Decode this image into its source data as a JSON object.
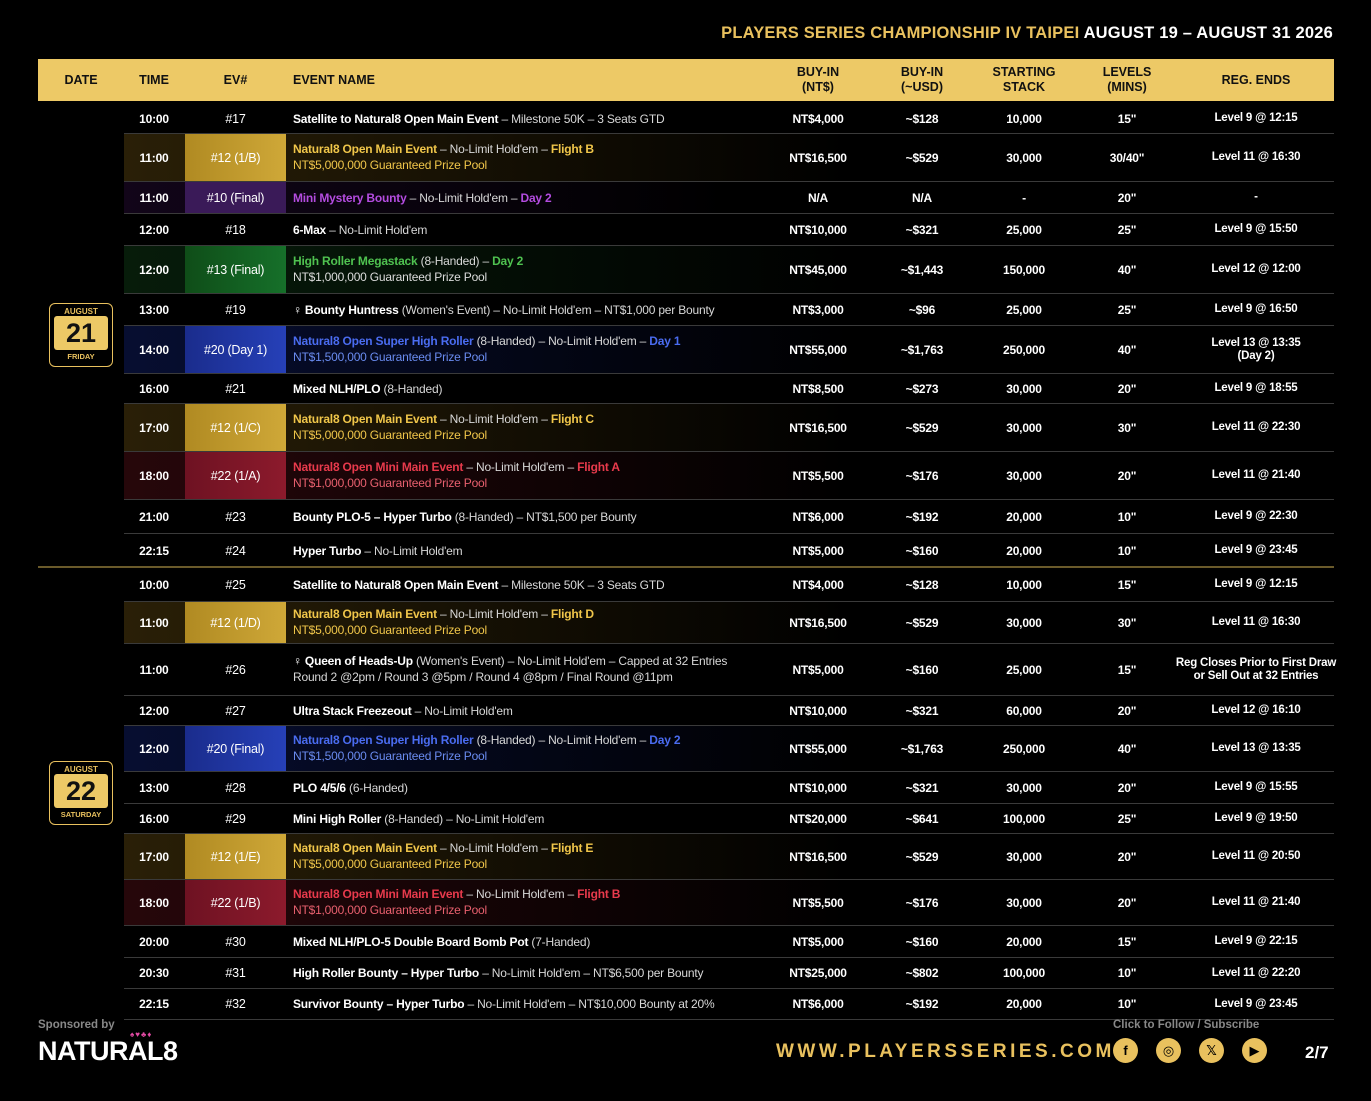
{
  "title": {
    "gold": "PLAYERS SERIES CHAMPIONSHIP IV TAIPEI",
    "white": "AUGUST 19 – AUGUST 31 2026"
  },
  "headers": {
    "date": "DATE",
    "time": "TIME",
    "ev": "EV#",
    "name": "EVENT NAME",
    "buyin_nt": "BUY-IN\n(NT$)",
    "buyin_usd": "BUY-IN\n(~USD)",
    "stack": "STARTING\nSTACK",
    "levels": "LEVELS\n(MINS)",
    "reg": "REG. ENDS"
  },
  "days": [
    {
      "month": "AUGUST",
      "day": "21",
      "dow": "FRIDAY"
    },
    {
      "month": "AUGUST",
      "day": "22",
      "dow": "SATURDAY"
    }
  ],
  "rows": [
    {
      "time": "10:00",
      "ev": "#17",
      "name": "Satellite to Natural8 Open Main Event",
      "rest": " – Milestone 50K – 3 Seats GTD",
      "sub": "",
      "nt": "NT$4,000",
      "usd": "~$128",
      "stack": "10,000",
      "lvl": "15\"",
      "reg": "Level 9 @ 12:15",
      "h": 30
    },
    {
      "time": "11:00",
      "ev": "#12 (1/B)",
      "color": "gold",
      "name": "Natural8 Open Main Event",
      "rest": " – No-Limit Hold'em – ",
      "flight": "Flight B",
      "sub": "NT$5,000,000 Guaranteed Prize Pool",
      "nt": "NT$16,500",
      "usd": "~$529",
      "stack": "30,000",
      "lvl": "30/40\"",
      "reg": "Level 11 @ 16:30",
      "h": 48
    },
    {
      "time": "11:00",
      "ev": "#10 (Final)",
      "color": "purple",
      "name": "Mini Mystery Bounty",
      "rest": " – No-Limit Hold'em – ",
      "flight": "Day 2",
      "sub": "",
      "nt": "N/A",
      "usd": "N/A",
      "stack": "-",
      "lvl": "20\"",
      "reg": "-",
      "h": 32
    },
    {
      "time": "12:00",
      "ev": "#18",
      "name": "6-Max",
      "rest": " – No-Limit Hold'em",
      "sub": "",
      "nt": "NT$10,000",
      "usd": "~$321",
      "stack": "25,000",
      "lvl": "25\"",
      "reg": "Level 9 @ 15:50",
      "h": 32
    },
    {
      "time": "12:00",
      "ev": "#13 (Final)",
      "color": "green",
      "name": "High Roller Megastack",
      "rest": " (8-Handed) – ",
      "flight": "Day 2",
      "sub": "NT$1,000,000 Guaranteed Prize Pool",
      "nt": "NT$45,000",
      "usd": "~$1,443",
      "stack": "150,000",
      "lvl": "40\"",
      "reg": "Level 12 @ 12:00",
      "h": 48
    },
    {
      "time": "13:00",
      "ev": "#19",
      "name": "♀ Bounty Huntress",
      "rest": " (Women's Event) – No-Limit Hold'em – NT$1,000 per Bounty",
      "sub": "",
      "nt": "NT$3,000",
      "usd": "~$96",
      "stack": "25,000",
      "lvl": "25\"",
      "reg": "Level 9 @ 16:50",
      "h": 32
    },
    {
      "time": "14:00",
      "ev": "#20 (Day 1)",
      "color": "blue",
      "name": "Natural8 Open Super High Roller",
      "rest": " (8-Handed) – No-Limit Hold'em – ",
      "flight": "Day 1",
      "sub": "NT$1,500,000 Guaranteed Prize Pool",
      "nt": "NT$55,000",
      "usd": "~$1,763",
      "stack": "250,000",
      "lvl": "40\"",
      "reg": "Level 13 @ 13:35\n(Day 2)",
      "h": 48
    },
    {
      "time": "16:00",
      "ev": "#21",
      "name": "Mixed NLH/PLO",
      "rest": " (8-Handed)",
      "sub": "",
      "nt": "NT$8,500",
      "usd": "~$273",
      "stack": "30,000",
      "lvl": "20\"",
      "reg": "Level 9 @ 18:55",
      "h": 30
    },
    {
      "time": "17:00",
      "ev": "#12 (1/C)",
      "color": "gold",
      "name": "Natural8 Open Main Event",
      "rest": " – No-Limit Hold'em – ",
      "flight": "Flight C",
      "sub": "NT$5,000,000 Guaranteed Prize Pool",
      "nt": "NT$16,500",
      "usd": "~$529",
      "stack": "30,000",
      "lvl": "30\"",
      "reg": "Level 11 @ 22:30",
      "h": 48
    },
    {
      "time": "18:00",
      "ev": "#22 (1/A)",
      "color": "red",
      "name": "Natural8 Open Mini Main Event",
      "rest": " – No-Limit Hold'em – ",
      "flight": "Flight A",
      "sub": "NT$1,000,000 Guaranteed Prize Pool",
      "nt": "NT$5,500",
      "usd": "~$176",
      "stack": "30,000",
      "lvl": "20\"",
      "reg": "Level 11 @ 21:40",
      "h": 48
    },
    {
      "time": "21:00",
      "ev": "#23",
      "name": "Bounty PLO-5 – Hyper Turbo",
      "rest": " (8-Handed) – NT$1,500 per Bounty",
      "sub": "",
      "nt": "NT$6,000",
      "usd": "~$192",
      "stack": "20,000",
      "lvl": "10\"",
      "reg": "Level 9 @ 22:30",
      "h": 34
    },
    {
      "time": "22:15",
      "ev": "#24",
      "name": "Hyper Turbo",
      "rest": " – No-Limit Hold'em",
      "sub": "",
      "nt": "NT$5,000",
      "usd": "~$160",
      "stack": "20,000",
      "lvl": "10\"",
      "reg": "Level 9 @ 23:45",
      "h": 34
    },
    {
      "time": "10:00",
      "ev": "#25",
      "name": "Satellite to Natural8 Open Main Event",
      "rest": " – Milestone 50K – 3 Seats GTD",
      "sub": "",
      "nt": "NT$4,000",
      "usd": "~$128",
      "stack": "10,000",
      "lvl": "15\"",
      "reg": "Level 9 @ 12:15",
      "h": 34,
      "gap": true
    },
    {
      "time": "11:00",
      "ev": "#12 (1/D)",
      "color": "gold",
      "name": "Natural8 Open Main Event",
      "rest": " – No-Limit Hold'em – ",
      "flight": "Flight D",
      "sub": "NT$5,000,000 Guaranteed Prize Pool",
      "nt": "NT$16,500",
      "usd": "~$529",
      "stack": "30,000",
      "lvl": "30\"",
      "reg": "Level 11 @ 16:30",
      "h": 42
    },
    {
      "time": "11:00",
      "ev": "#26",
      "name": "♀ Queen of Heads-Up",
      "rest": " (Women's Event) – No-Limit Hold'em – Capped at 32 Entries",
      "sub": "Round 2 @2pm / Round 3 @5pm / Round 4 @8pm / Final Round @11pm",
      "plain": true,
      "nt": "NT$5,000",
      "usd": "~$160",
      "stack": "25,000",
      "lvl": "15\"",
      "reg": "Reg Closes Prior to First Draw\nor Sell Out at 32 Entries",
      "h": 52
    },
    {
      "time": "12:00",
      "ev": "#27",
      "name": "Ultra Stack Freezeout",
      "rest": " – No-Limit Hold'em",
      "sub": "",
      "nt": "NT$10,000",
      "usd": "~$321",
      "stack": "60,000",
      "lvl": "20\"",
      "reg": "Level 12 @ 16:10",
      "h": 30
    },
    {
      "time": "12:00",
      "ev": "#20 (Final)",
      "color": "blue",
      "name": "Natural8 Open Super High Roller",
      "rest": " (8-Handed) – No-Limit Hold'em – ",
      "flight": "Day 2",
      "sub": "NT$1,500,000 Guaranteed Prize Pool",
      "nt": "NT$55,000",
      "usd": "~$1,763",
      "stack": "250,000",
      "lvl": "40\"",
      "reg": "Level 13 @ 13:35",
      "h": 46
    },
    {
      "time": "13:00",
      "ev": "#28",
      "name": "PLO 4/5/6",
      "rest": " (6-Handed)",
      "sub": "",
      "nt": "NT$10,000",
      "usd": "~$321",
      "stack": "30,000",
      "lvl": "20\"",
      "reg": "Level 9 @ 15:55",
      "h": 32
    },
    {
      "time": "16:00",
      "ev": "#29",
      "name": "Mini High Roller",
      "rest": " (8-Handed) – No-Limit Hold'em",
      "sub": "",
      "nt": "NT$20,000",
      "usd": "~$641",
      "stack": "100,000",
      "lvl": "25\"",
      "reg": "Level 9 @ 19:50",
      "h": 30
    },
    {
      "time": "17:00",
      "ev": "#12 (1/E)",
      "color": "gold",
      "name": "Natural8 Open Main Event",
      "rest": " – No-Limit Hold'em – ",
      "flight": "Flight E",
      "sub": "NT$5,000,000 Guaranteed Prize Pool",
      "nt": "NT$16,500",
      "usd": "~$529",
      "stack": "30,000",
      "lvl": "20\"",
      "reg": "Level 11 @ 20:50",
      "h": 46
    },
    {
      "time": "18:00",
      "ev": "#22 (1/B)",
      "color": "red",
      "name": "Natural8 Open Mini Main Event",
      "rest": " – No-Limit Hold'em – ",
      "flight": "Flight B",
      "sub": "NT$1,000,000 Guaranteed Prize Pool",
      "nt": "NT$5,500",
      "usd": "~$176",
      "stack": "30,000",
      "lvl": "20\"",
      "reg": "Level 11 @ 21:40",
      "h": 46
    },
    {
      "time": "20:00",
      "ev": "#30",
      "name": "Mixed NLH/PLO-5 Double Board Bomb Pot",
      "rest": " (7-Handed)",
      "sub": "",
      "nt": "NT$5,000",
      "usd": "~$160",
      "stack": "20,000",
      "lvl": "15\"",
      "reg": "Level 9 @ 22:15",
      "h": 32
    },
    {
      "time": "20:30",
      "ev": "#31",
      "name": "High Roller Bounty – Hyper Turbo",
      "rest": " – No-Limit Hold'em – NT$6,500 per Bounty",
      "sub": "",
      "nt": "NT$25,000",
      "usd": "~$802",
      "stack": "100,000",
      "lvl": "10\"",
      "reg": "Level 11 @ 22:20",
      "h": 31
    },
    {
      "time": "22:15",
      "ev": "#32",
      "name": "Survivor Bounty – Hyper Turbo",
      "rest": " – No-Limit Hold'em – NT$10,000 Bounty at 20%",
      "sub": "",
      "nt": "NT$6,000",
      "usd": "~$192",
      "stack": "20,000",
      "lvl": "10\"",
      "reg": "Level 9 @ 23:45",
      "h": 31
    }
  ],
  "footer": {
    "sponsored": "Sponsored by",
    "logo": "NATURAL8",
    "url": "WWW.PLAYERSSERIES.COM",
    "follow": "Click to Follow / Subscribe",
    "page": "2/7",
    "icons": [
      "facebook-icon",
      "instagram-icon",
      "x-icon",
      "youtube-icon"
    ]
  }
}
